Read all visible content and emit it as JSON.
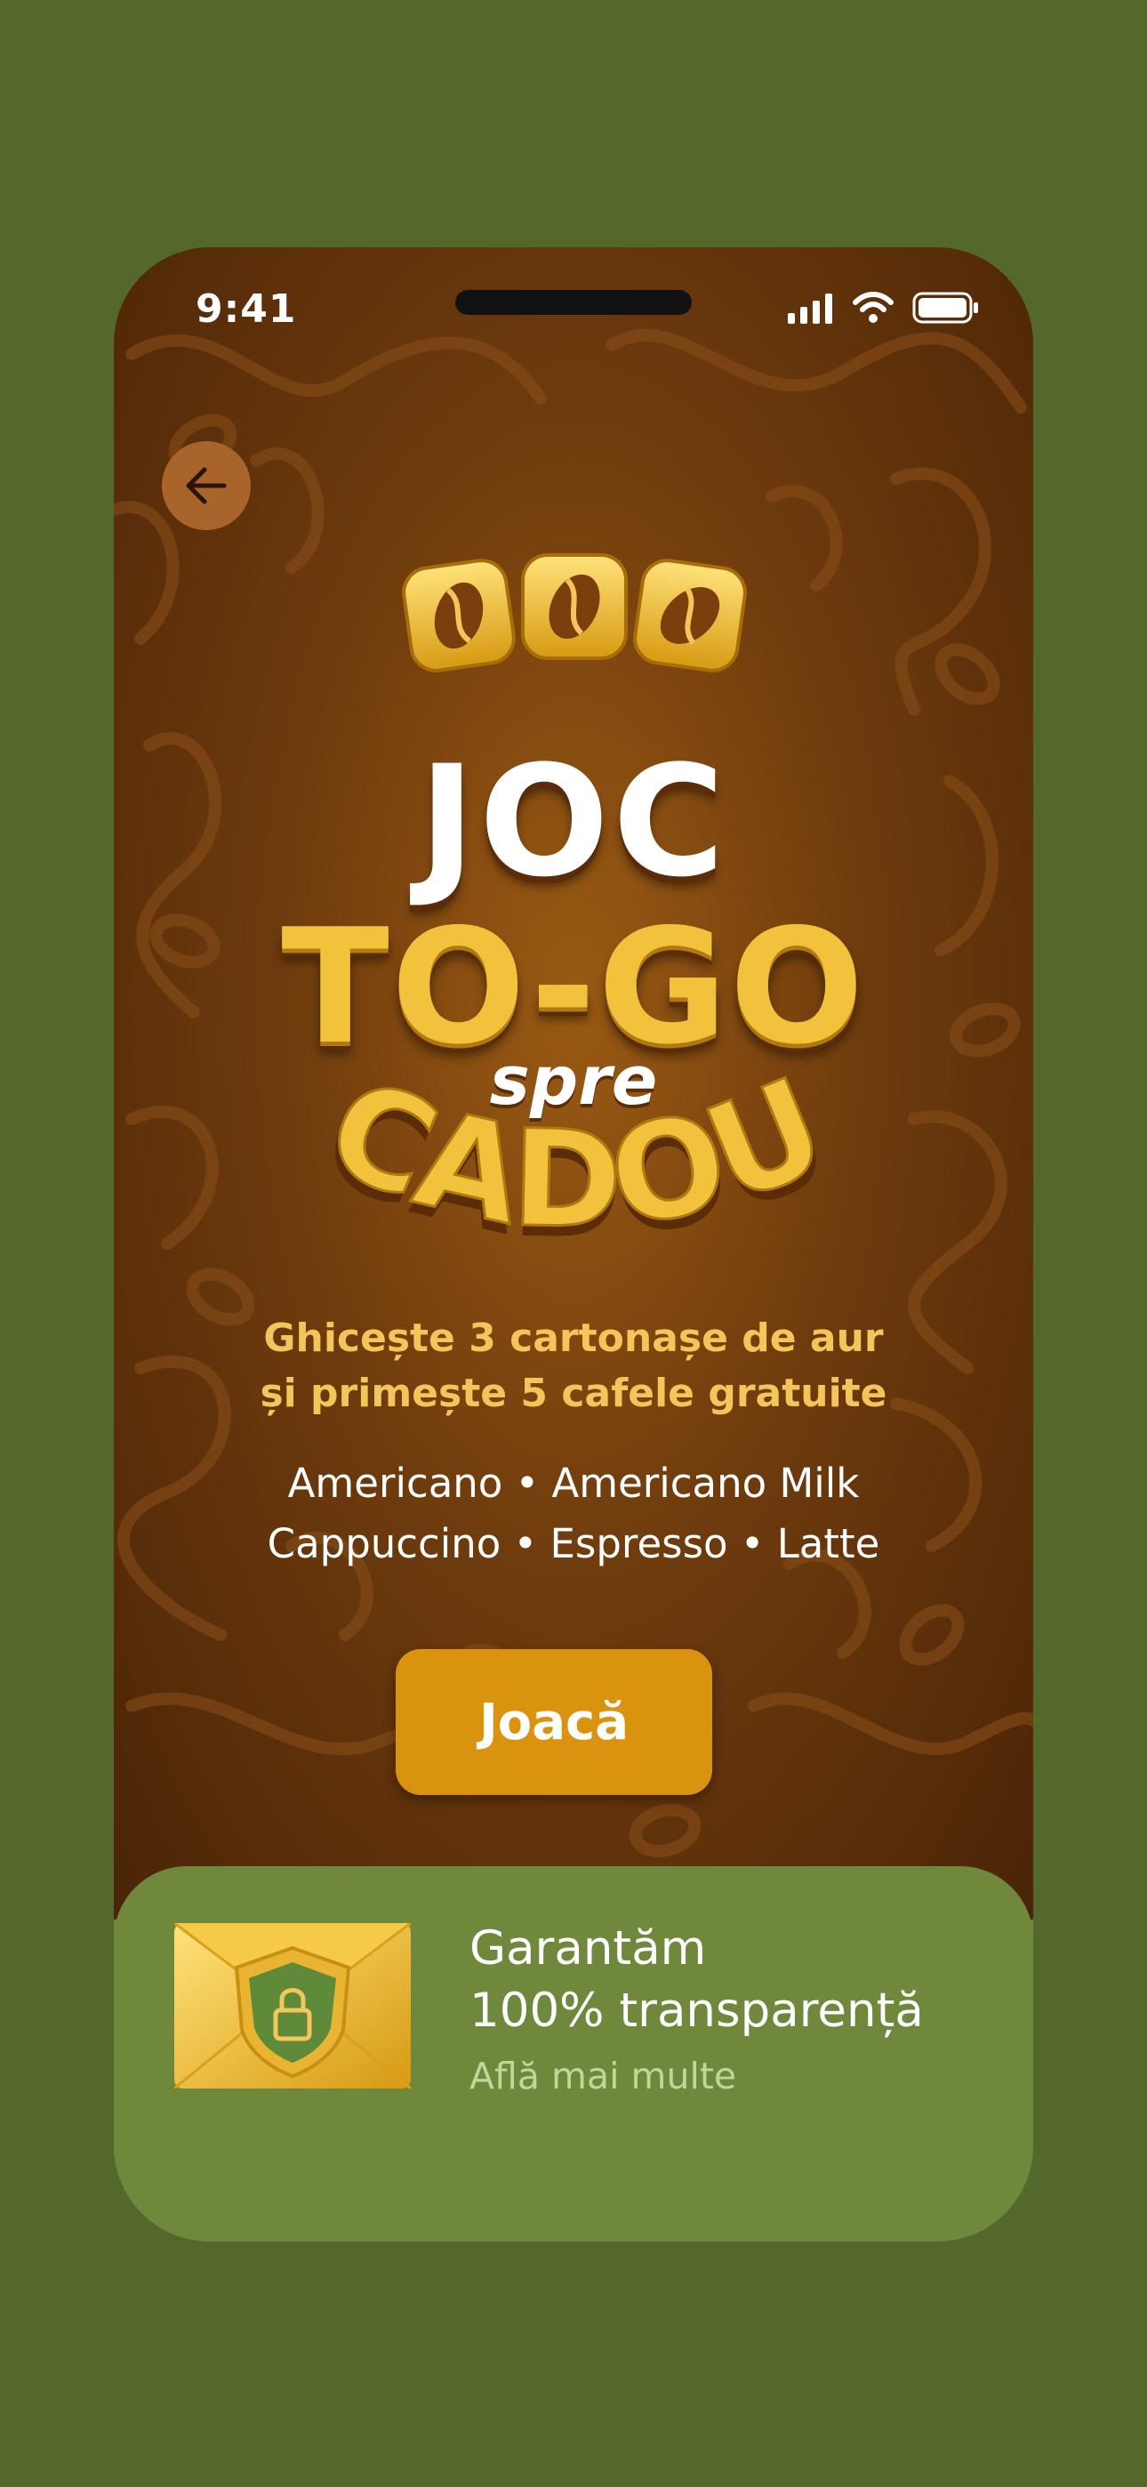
{
  "status_bar": {
    "time": "9:41"
  },
  "title": {
    "line1": "JOC",
    "line2": "TO-GO",
    "line3": "spre",
    "line4": "CADOU"
  },
  "description": {
    "highlight_line1": "Ghicește 3 cartonașe de aur",
    "highlight_line2": "și primește 5 cafele gratuite",
    "products_line1": "Americano • Americano Milk",
    "products_line2": "Cappuccino • Espresso • Latte"
  },
  "play_button": {
    "label": "Joacă"
  },
  "info_card": {
    "title_line1": "Garantăm",
    "title_line2": "100% transparență",
    "link": "Află mai multe"
  },
  "icons": [
    "back-arrow-icon",
    "coffee-bean-icon",
    "signal-icon",
    "wifi-icon",
    "battery-icon",
    "shield-lock-icon"
  ],
  "colors": {
    "background": "#54682b",
    "screen_brown": "#6e3b0d",
    "gold": "#f2c23c",
    "button": "#d9930f",
    "card_green": "#6f883c",
    "link_green": "#c4d59a"
  }
}
